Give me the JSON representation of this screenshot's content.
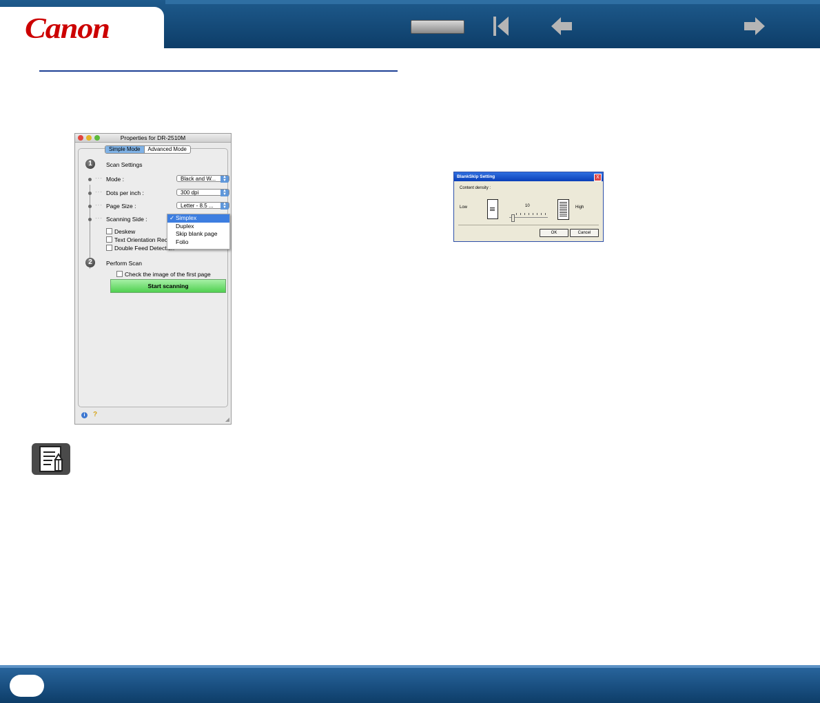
{
  "header": {
    "brand": "Canon",
    "nav_icons": [
      "toc-button",
      "first-page-icon",
      "previous-page-icon",
      "next-page-icon"
    ]
  },
  "mac_dialog": {
    "title": "Properties for DR-2510M",
    "tabs": [
      {
        "label": "Simple Mode",
        "selected": true
      },
      {
        "label": "Advanced Mode",
        "selected": false
      }
    ],
    "step1": {
      "number": "1",
      "label": "Scan Settings"
    },
    "settings": [
      {
        "label": "Mode :",
        "value": "Black and W..."
      },
      {
        "label": "Dots per inch :",
        "value": "300 dpi"
      },
      {
        "label": "Page Size :",
        "value": "Letter - 8.5 ..."
      },
      {
        "label": "Scanning Side :",
        "value": ""
      }
    ],
    "checkboxes": [
      "Deskew",
      "Text Orientation Reco",
      "Double Feed Detection"
    ],
    "menu": {
      "items": [
        "Simplex",
        "Duplex",
        "Skip blank page",
        "Folio"
      ],
      "selected": "Simplex"
    },
    "step2": {
      "number": "2",
      "label": "Perform Scan"
    },
    "check_first_page": "Check the image of the first page",
    "start_button": "Start scanning",
    "info_icon": "i",
    "help_icon": "?"
  },
  "win_dialog": {
    "title": "BlankSkip Setting",
    "close": "X",
    "content_label": "Content density :",
    "low_label": "Low",
    "high_label": "High",
    "slider_value": "10",
    "ok_label": "OK",
    "cancel_label": "Cancel"
  },
  "colors": {
    "header": "#0d3d68",
    "accent": "#1c3f94",
    "logo": "#cc0000",
    "start": "#50d050"
  }
}
